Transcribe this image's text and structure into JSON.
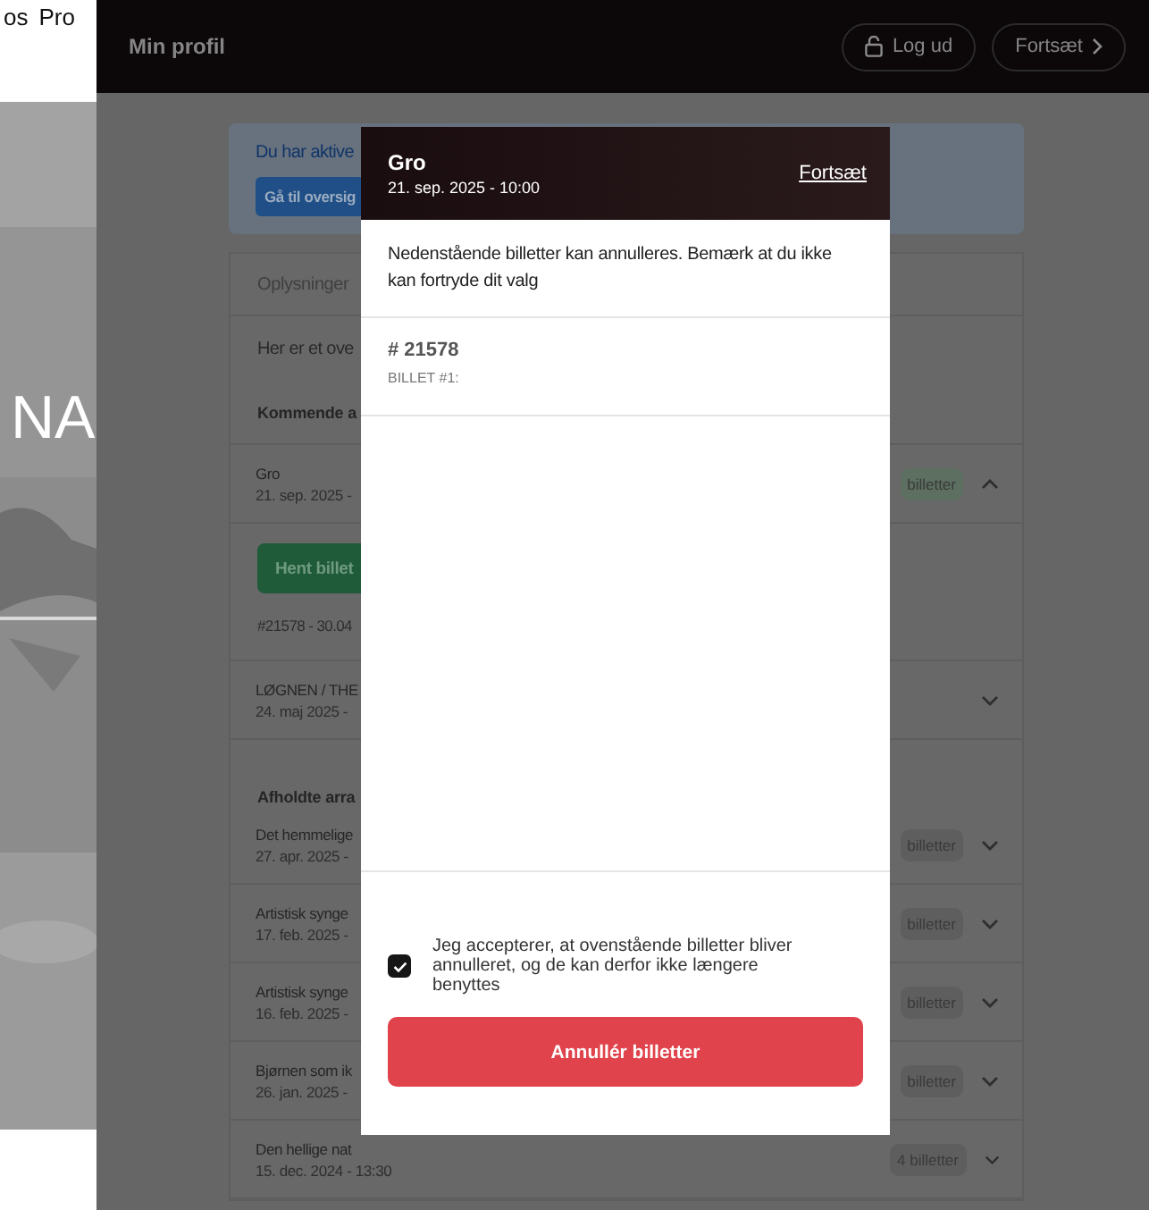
{
  "site": {
    "nav": [
      "os",
      "Pro"
    ],
    "hero_title": "NA"
  },
  "header": {
    "title": "Min profil",
    "buttons": [
      {
        "label": "Log ud"
      },
      {
        "label": "Fortsæt"
      }
    ]
  },
  "notice": {
    "text": "Du har aktive",
    "button": "Gå til oversig"
  },
  "card": {
    "tab": "Oplysninger",
    "intro": "Her er et ove",
    "sections": [
      {
        "heading": "Kommende a",
        "events": [
          {
            "title": "Gro",
            "date": "21. sep. 2025 -",
            "badge": "billetter",
            "color": "#5c6f60",
            "expanded": true,
            "download": "Hent billet",
            "order": "#21578 - 30.04"
          },
          {
            "title": "LØGNEN / THE",
            "date": "24. maj 2025 -",
            "expanded": false
          }
        ]
      },
      {
        "heading": "Afholdte arra",
        "events": [
          {
            "title": "Det hemmelige",
            "date": "27. apr. 2025 -",
            "badge": "billetter",
            "color": "#5e5e5e",
            "expanded": false
          },
          {
            "title": "Artistisk synge",
            "date": "17. feb. 2025 -",
            "badge": "billetter",
            "color": "#5e5e5e",
            "expanded": false
          },
          {
            "title": "Artistisk synge",
            "date": "16. feb. 2025 -",
            "badge": "billetter",
            "color": "#5e5e5e",
            "expanded": false
          },
          {
            "title": "Bjørnen som ik",
            "date": "26. jan. 2025 -",
            "badge": "billetter",
            "color": "#5e5e5e",
            "expanded": false
          },
          {
            "title": "Den hellige nat",
            "date": "15. dec. 2024 - 13:30",
            "badge": "4 billetter",
            "color": "#5e5e5e",
            "expanded": false
          }
        ]
      }
    ]
  },
  "modal": {
    "title": "Gro",
    "date": "21. sep. 2025 - 10:00",
    "link": "Fortsæt",
    "message": "Nedenstående billetter kan annulleres. Bemærk at du ikke kan fortryde dit valg",
    "ticket": {
      "number": "# 21578",
      "label": "BILLET #1:"
    },
    "consent": {
      "checked": true,
      "text": "Jeg accepterer, at ovenstående billetter bliver annulleret, og de kan derfor ikke længere benyttes"
    },
    "button": "Annullér billetter"
  }
}
